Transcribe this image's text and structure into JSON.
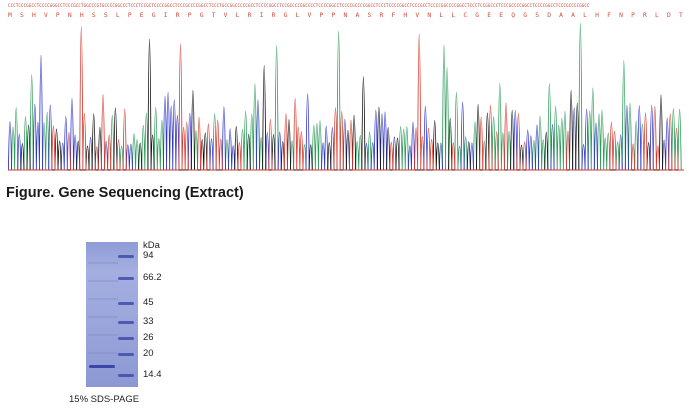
{
  "sequencing": {
    "base_row": "CCCTCCCGGCCTCCCCGGGCCTCCCGCCTGGCCCGTGCCCCGGCCCTCCCTCCGCTCCCCGGCCTCCCGCCCCGGCCTCCCTGCCGGCCCCCGCCTCCCCGGCCTCCGCCCCGGCCCCTCCCCGGCCTCCCCGCCCCGGCCTCCCTCCCCGGCCTCCCGCCTCCCCGGCCCCGGCCTCCCTCCGGCCCTCCCGCCCCGGCCTCCCCGGCCTCCCGCCCCGGCC",
    "amino_acid_row": "M S H V P N H S S L P E G I R P G T V L R I R G L V P P N A S R F H V N L L C G E E Q G S D A A L H F N P R L D T S E V V F N S K E Q G S W G R E E R G P G V P F Q R G Q P F E V L I I A S D D G F K A",
    "caption": "Figure. Gene Sequencing (Extract)"
  },
  "gel": {
    "unit_label": "kDa",
    "markers": [
      {
        "label": "94",
        "value": 94
      },
      {
        "label": "66.2",
        "value": 66.2
      },
      {
        "label": "45",
        "value": 45
      },
      {
        "label": "33",
        "value": 33
      },
      {
        "label": "26",
        "value": 26
      },
      {
        "label": "20",
        "value": 20
      },
      {
        "label": "14.4",
        "value": 14.4
      }
    ],
    "caption": "15% SDS-PAGE"
  },
  "colors": {
    "trace_A": "#2e9b5a",
    "trace_C": "#2f37c9",
    "trace_G": "#111111",
    "trace_T": "#d63a2f",
    "gel_band": "#3a47a8"
  }
}
